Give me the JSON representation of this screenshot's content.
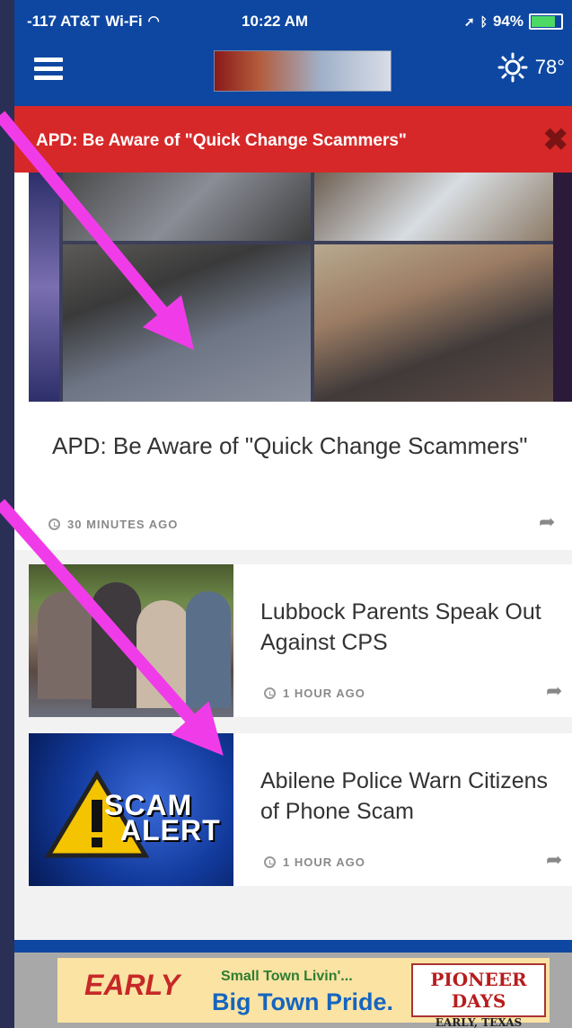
{
  "status_bar": {
    "carrier": "-117 AT&T",
    "network": "Wi-Fi",
    "time": "10:22 AM",
    "battery": "94%",
    "battery_fraction": 0.94
  },
  "nav": {
    "weather_temp": "78°",
    "icons": [
      "menu-icon",
      "sun-icon"
    ]
  },
  "alert": {
    "text": "APD: Be Aware of \"Quick Change Scammers\"",
    "close_icon": "close-icon"
  },
  "hero": {
    "title": "APD: Be Aware of \"Quick Change Scammers\"",
    "time_ago": "30 MINUTES AGO"
  },
  "stories": [
    {
      "title": "Lubbock Parents Speak Out Against CPS",
      "time_ago": "1 HOUR AGO"
    },
    {
      "title": "Abilene Police Warn Citizens of Phone Scam",
      "time_ago": "1 HOUR AGO"
    }
  ],
  "scam_thumb": {
    "line1": "SCAM",
    "line2": "ALERT"
  },
  "ad": {
    "brand": "EARLY",
    "tagline1": "Small Town Livin'...",
    "tagline2": "Big Town Pride.",
    "logo_line1": "PIONEER DAYS",
    "logo_line2": "EARLY, TEXAS"
  },
  "colors": {
    "header_blue": "#0d47a1",
    "alert_red": "#d62828",
    "arrow_magenta": "#f03ce8"
  }
}
